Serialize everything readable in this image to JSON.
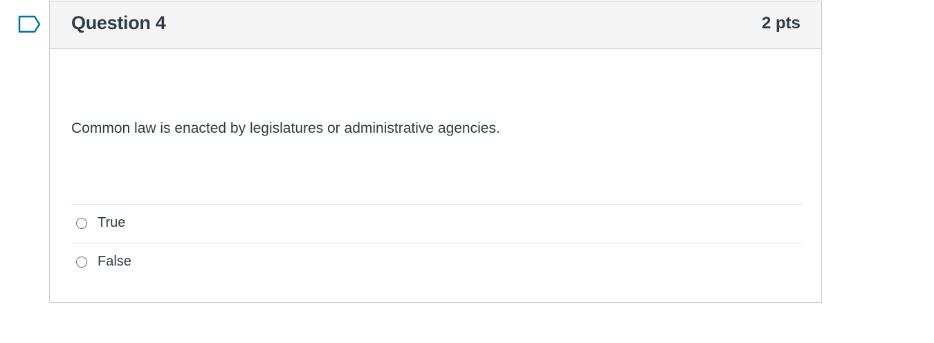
{
  "question": {
    "title": "Question 4",
    "points": "2 pts",
    "text": "Common law is enacted by legislatures or administrative agencies.",
    "answers": [
      {
        "label": "True",
        "selected": false
      },
      {
        "label": "False",
        "selected": false
      }
    ]
  },
  "icons": {
    "flag": "bookmark-flag-icon"
  },
  "colors": {
    "flag_outline": "#0770a3",
    "header_bg": "#f5f5f5",
    "border": "#c7cdd1",
    "text": "#2d3b45"
  }
}
